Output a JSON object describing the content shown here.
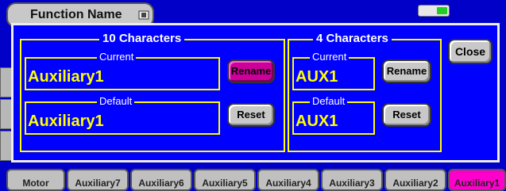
{
  "background": {
    "title_button_label": "Function Name",
    "tabs": [
      {
        "label": "Motor"
      },
      {
        "label": "Auxiliary7"
      },
      {
        "label": "Auxiliary6"
      },
      {
        "label": "Auxiliary5"
      },
      {
        "label": "Auxiliary4"
      },
      {
        "label": "Auxiliary3"
      },
      {
        "label": "Auxiliary2"
      },
      {
        "label": "Auxiliary1"
      }
    ],
    "active_tab": "Auxiliary1"
  },
  "dialog": {
    "ten_char_group": {
      "title": "10 Characters",
      "current_label": "Current",
      "current_value": "Auxiliary1",
      "default_label": "Default",
      "default_value": "Auxiliary1",
      "rename_label": "Rename",
      "reset_label": "Reset"
    },
    "four_char_group": {
      "title": "4 Characters",
      "current_label": "Current",
      "current_value": "AUX1",
      "default_label": "Default",
      "default_value": "AUX1",
      "rename_label": "Rename",
      "reset_label": "Reset"
    },
    "close_label": "Close"
  },
  "colors": {
    "dialog_bg": "#0000ff",
    "frame": "#ffff00",
    "value_text": "#ffff00",
    "highlight_button": "#cc0099",
    "active_tab": "#ff00cc"
  }
}
